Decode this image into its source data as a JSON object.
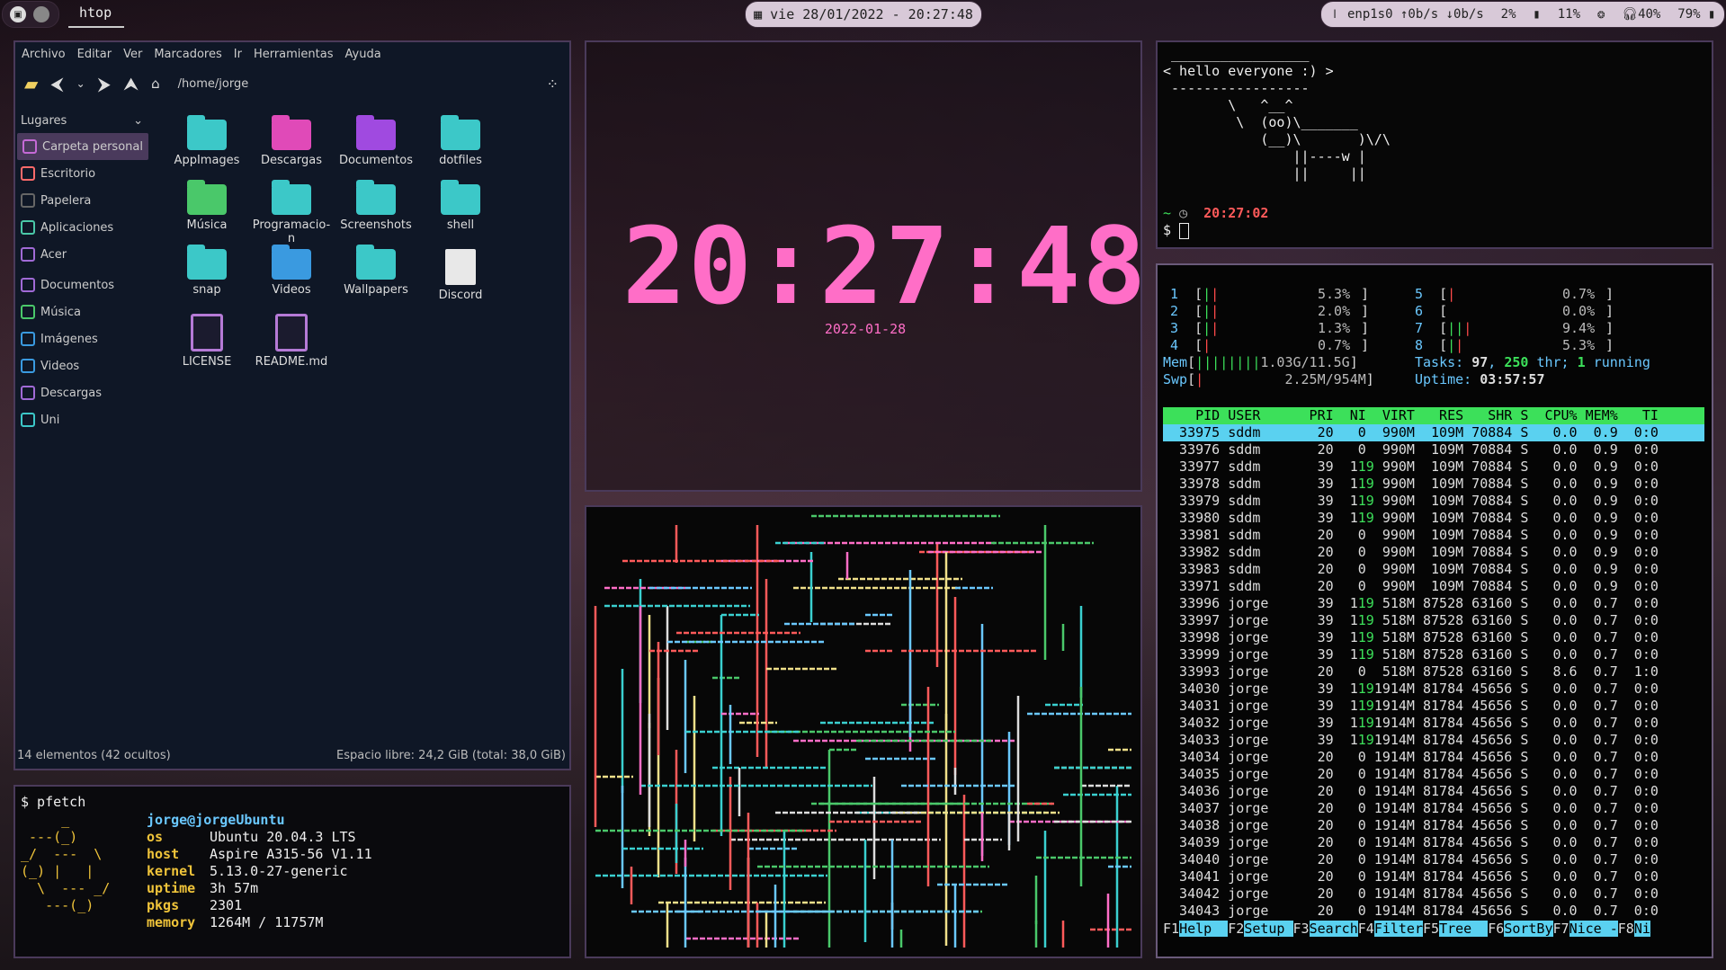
{
  "topbar": {
    "window_title": "htop",
    "datetime": "vie 28/01/2022 - 20:27:48",
    "net_iface": "enp1s0",
    "net_up": "0b/s",
    "net_down": "0b/s",
    "cpu": "2%",
    "mem": "11%",
    "volume": "40%",
    "battery": "79%"
  },
  "file_manager": {
    "menu": [
      "Archivo",
      "Editar",
      "Ver",
      "Marcadores",
      "Ir",
      "Herramientas",
      "Ayuda"
    ],
    "path": "/home/jorge",
    "sidebar_header": "Lugares",
    "sidebar": [
      "Carpeta personal",
      "Escritorio",
      "Papelera",
      "Aplicaciones",
      "Acer",
      "Documentos",
      "Música",
      "Imágenes",
      "Videos",
      "Descargas",
      "Uni"
    ],
    "items": [
      {
        "label": "AppImages",
        "kind": "folder",
        "color": "#3cc8c8"
      },
      {
        "label": "Descargas",
        "kind": "folder",
        "color": "#e04ab8"
      },
      {
        "label": "Documentos",
        "kind": "folder",
        "color": "#a04ae0"
      },
      {
        "label": "dotfiles",
        "kind": "folder",
        "color": "#3cc8c8"
      },
      {
        "label": "Música",
        "kind": "folder",
        "color": "#4ac86a"
      },
      {
        "label": "Programacio-\nn",
        "kind": "folder",
        "color": "#3cc8c8"
      },
      {
        "label": "Screenshots",
        "kind": "folder",
        "color": "#3cc8c8"
      },
      {
        "label": "shell",
        "kind": "folder",
        "color": "#3cc8c8"
      },
      {
        "label": "snap",
        "kind": "folder",
        "color": "#3cc8c8"
      },
      {
        "label": "Videos",
        "kind": "folder",
        "color": "#3a9ae0"
      },
      {
        "label": "Wallpapers",
        "kind": "folder",
        "color": "#3cc8c8"
      },
      {
        "label": "Discord",
        "kind": "file",
        "color": "#e8e8e8"
      },
      {
        "label": "LICENSE",
        "kind": "doc",
        "color": "#b57ad6"
      },
      {
        "label": "README.md",
        "kind": "doc",
        "color": "#b57ad6"
      }
    ],
    "status_left": "14 elementos (42 ocultos)",
    "status_right": "Espacio libre: 24,2 GiB (total: 38,0 GiB)"
  },
  "pfetch": {
    "prompt": "$ pfetch",
    "user": "jorge@jorgeUbuntu",
    "logo": "     _\n ---(_)\n_/  ---  \\\n(_) |   |\n  \\  --- _/\n   ---(_)",
    "rows": [
      {
        "k": "os",
        "v": "Ubuntu 20.04.3 LTS"
      },
      {
        "k": "host",
        "v": "Aspire A315-56 V1.11"
      },
      {
        "k": "kernel",
        "v": "5.13.0-27-generic"
      },
      {
        "k": "uptime",
        "v": "3h 57m"
      },
      {
        "k": "pkgs",
        "v": "2301"
      },
      {
        "k": "memory",
        "v": "1264M / 11757M"
      }
    ]
  },
  "clock": {
    "time": "20:27:48",
    "date": "2022-01-28"
  },
  "cowsay": {
    "text": " _________________\n< hello everyone :) >\n -----------------\n        \\   ^__^\n         \\  (oo)\\_______\n            (__)\\       )\\/\\\n                ||----w |\n                ||     ||",
    "prompt_time": "20:27:02",
    "prompt_tilde": "~",
    "prompt_dollar": "$"
  },
  "htop": {
    "cpus": [
      {
        "n": "1",
        "pct": "5.3%"
      },
      {
        "n": "2",
        "pct": "2.0%"
      },
      {
        "n": "3",
        "pct": "1.3%"
      },
      {
        "n": "4",
        "pct": "0.7%"
      },
      {
        "n": "5",
        "pct": "0.7%"
      },
      {
        "n": "6",
        "pct": "0.0%"
      },
      {
        "n": "7",
        "pct": "9.4%"
      },
      {
        "n": "8",
        "pct": "5.3%"
      }
    ],
    "mem": "1.03G/11.5G",
    "swp": "2.25M/954M",
    "tasks": "97",
    "threads": "250",
    "running": "1",
    "uptime": "03:57:57",
    "columns": "    PID USER      PRI  NI  VIRT   RES   SHR S  CPU% MEM%   TI",
    "processes": [
      "  33975 sddm       20   0  990M  109M 70884 S   0.0  0.9  0:0",
      "  33976 sddm       20   0  990M  109M 70884 S   0.0  0.9  0:0",
      "  33977 sddm       39  19  990M  109M 70884 S   0.0  0.9  0:0",
      "  33978 sddm       39  19  990M  109M 70884 S   0.0  0.9  0:0",
      "  33979 sddm       39  19  990M  109M 70884 S   0.0  0.9  0:0",
      "  33980 sddm       39  19  990M  109M 70884 S   0.0  0.9  0:0",
      "  33981 sddm       20   0  990M  109M 70884 S   0.0  0.9  0:0",
      "  33982 sddm       20   0  990M  109M 70884 S   0.0  0.9  0:0",
      "  33983 sddm       20   0  990M  109M 70884 S   0.0  0.9  0:0",
      "  33971 sddm       20   0  990M  109M 70884 S   0.0  0.9  0:0",
      "  33996 jorge      39  19  518M 87528 63160 S   0.0  0.7  0:0",
      "  33997 jorge      39  19  518M 87528 63160 S   0.0  0.7  0:0",
      "  33998 jorge      39  19  518M 87528 63160 S   0.0  0.7  0:0",
      "  33999 jorge      39  19  518M 87528 63160 S   0.0  0.7  0:0",
      "  33993 jorge      20   0  518M 87528 63160 S   8.6  0.7  1:0",
      "  34030 jorge      39  19 1914M 81784 45656 S   0.0  0.7  0:0",
      "  34031 jorge      39  19 1914M 81784 45656 S   0.0  0.7  0:0",
      "  34032 jorge      39  19 1914M 81784 45656 S   0.0  0.7  0:0",
      "  34033 jorge      39  19 1914M 81784 45656 S   0.0  0.7  0:0",
      "  34034 jorge      20   0 1914M 81784 45656 S   0.0  0.7  0:0",
      "  34035 jorge      20   0 1914M 81784 45656 S   0.0  0.7  0:0",
      "  34036 jorge      20   0 1914M 81784 45656 S   0.0  0.7  0:0",
      "  34037 jorge      20   0 1914M 81784 45656 S   0.0  0.7  0:0",
      "  34038 jorge      20   0 1914M 81784 45656 S   0.0  0.7  0:0",
      "  34039 jorge      20   0 1914M 81784 45656 S   0.0  0.7  0:0",
      "  34040 jorge      20   0 1914M 81784 45656 S   0.0  0.7  0:0",
      "  34041 jorge      20   0 1914M 81784 45656 S   0.0  0.7  0:0",
      "  34042 jorge      20   0 1914M 81784 45656 S   0.0  0.7  0:0",
      "  34043 jorge      20   0 1914M 81784 45656 S   0.0  0.7  0:0"
    ],
    "footer": [
      {
        "k": "F1",
        "l": "Help  "
      },
      {
        "k": "F2",
        "l": "Setup "
      },
      {
        "k": "F3",
        "l": "Search"
      },
      {
        "k": "F4",
        "l": "Filter"
      },
      {
        "k": "F5",
        "l": "Tree  "
      },
      {
        "k": "F6",
        "l": "SortBy"
      },
      {
        "k": "F7",
        "l": "Nice -"
      },
      {
        "k": "F8",
        "l": "Ni"
      }
    ]
  }
}
